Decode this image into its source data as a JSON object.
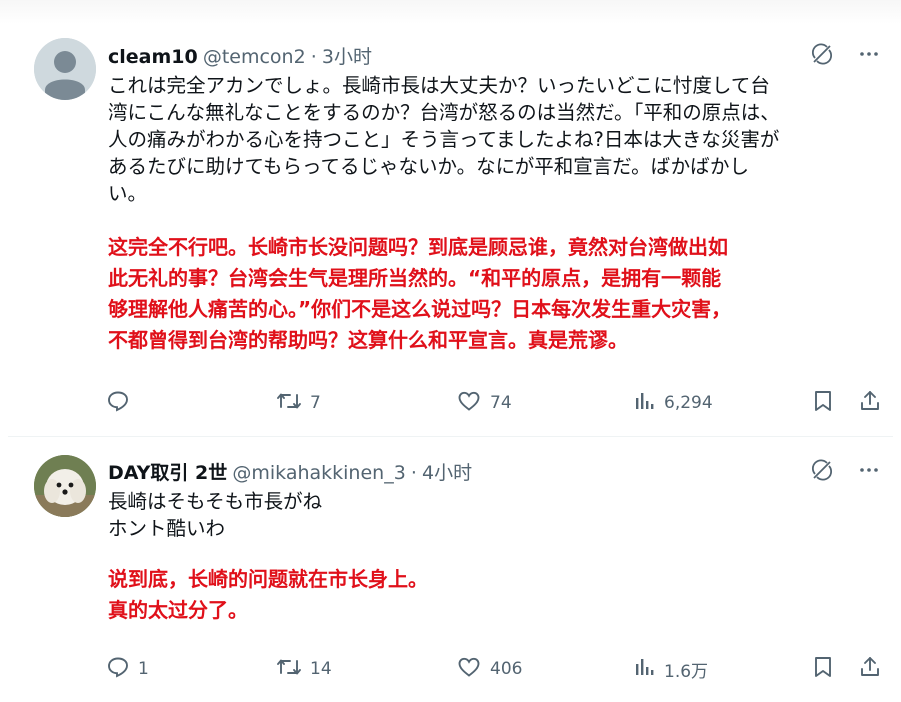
{
  "tweets": [
    {
      "name": "cleam10",
      "handle": "@temcon2",
      "separator": "·",
      "time": "3小时",
      "text_jp": [
        "これは完全アカンでしょ。長崎市長は大丈夫か？いったいどこに忖度して台",
        "湾にこんな無礼なことをするのか？台湾が怒るのは当然だ。「平和の原点は、",
        "人の痛みがわかる心を持つこと」そう言ってましたよね?日本は大きな災害が",
        "あるたびに助けてもらってるじゃないか。なにが平和宣言だ。ばかばかし",
        "い。"
      ],
      "text_cn": [
        "这完全不行吧。长崎市长没问题吗？到底是顾忌谁，竟然对台湾做出如",
        "此无礼的事？台湾会生气是理所当然的。“和平的原点，是拥有一颗能",
        "够理解他人痛苦的心。”你们不是这么说过吗？日本每次发生重大灾害，",
        "不都曾得到台湾的帮助吗？这算什么和平宣言。真是荒谬。"
      ],
      "replies": "",
      "retweets": "7",
      "likes": "74",
      "views": "6,294"
    },
    {
      "name": "DAY取引 2世",
      "handle": "@mikahakkinen_3",
      "separator": "·",
      "time": "4小时",
      "text_jp": [
        "長崎はそもそも市長がね",
        "ホント酷いわ"
      ],
      "text_cn": [
        "说到底，长崎的问题就在市长身上。",
        "真的太过分了。"
      ],
      "replies": "1",
      "retweets": "14",
      "likes": "406",
      "views": "1.6万"
    }
  ],
  "icons": [
    "grok-icon",
    "more-icon",
    "reply-icon",
    "retweet-icon",
    "like-icon",
    "views-icon",
    "bookmark-icon",
    "share-icon"
  ],
  "colors": {
    "text": "#0f1419",
    "secondary": "#536471",
    "translation_red": "#e0101a"
  }
}
